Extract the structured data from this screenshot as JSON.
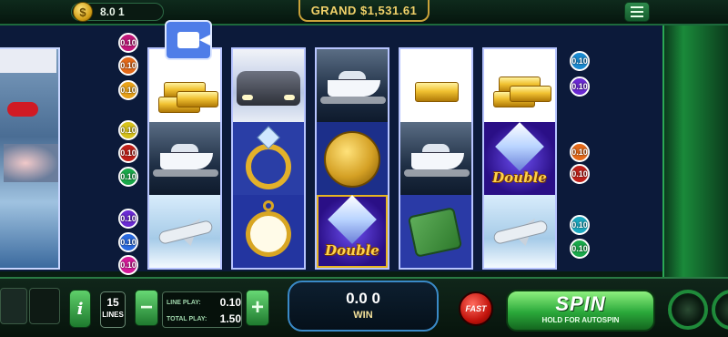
{
  "header": {
    "coin_value": "8.0 1",
    "coin_symbol": "$",
    "jackpot": "GRAND $1,531.61",
    "menu_icon": "hamburger-menu-icon"
  },
  "paylines_left": [
    "0.10",
    "0.10",
    "0.10",
    "0.10",
    "0.10",
    "0.10",
    "0.10",
    "0.10",
    "0.10"
  ],
  "paylines_right": [
    "0.10",
    "0.10",
    "0.10",
    "0.10",
    "0.10",
    "0.10"
  ],
  "reels": [
    [
      "gold-bars",
      "yacht",
      "jet"
    ],
    [
      "limousine",
      "diamond-ring",
      "gold-watch"
    ],
    [
      "yacht",
      "gold-coin",
      "double-diamond"
    ],
    [
      "gold-bar",
      "yacht",
      "money-stack"
    ],
    [
      "gold-bars",
      "double-diamond",
      "jet"
    ]
  ],
  "double_label": "Double",
  "controls": {
    "lines_count": "15",
    "lines_label": "LINES",
    "minus_label": "−",
    "plus_label": "+",
    "line_play_label": "LINE PLAY:",
    "line_play_value": "0.10",
    "total_play_label": "TOTAL PLAY:",
    "total_play_value": "1.50",
    "win_amount": "0.0 0",
    "win_label": "WIN",
    "fast_label": "FAST",
    "spin_label": "SPIN",
    "spin_sub": "HOLD FOR AUTOSPIN",
    "info_label": "i"
  },
  "colors": {
    "accent_green": "#2aa83a",
    "jackpot_gold": "#f2d26a",
    "reel_border": "#b7c4ff"
  }
}
